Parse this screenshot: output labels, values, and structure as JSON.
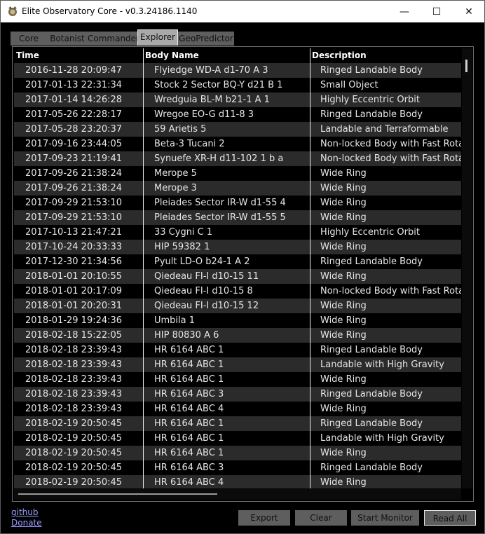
{
  "window": {
    "title": "Elite Observatory Core - v0.3.24186.1140",
    "minimize_glyph": "—",
    "maximize_glyph": "☐",
    "close_glyph": "✕"
  },
  "tabs": [
    "Core",
    "Botanist",
    "Commander",
    "Explorer",
    "GeoPredictor"
  ],
  "active_tab": "Explorer",
  "table": {
    "columns": [
      "Time",
      "Body Name",
      "Description"
    ],
    "rows": [
      [
        "2016-11-28 20:09:47",
        "Flyiedge WD-A d1-70 A 3",
        "Ringed Landable Body"
      ],
      [
        "2017-01-13 22:31:34",
        "Stock 2 Sector BQ-Y d21 B 1",
        "Small Object"
      ],
      [
        "2017-01-14 14:26:28",
        "Wredguia BL-M b21-1 A 1",
        "Highly Eccentric Orbit"
      ],
      [
        "2017-05-26 22:28:17",
        "Wregoe EO-G d11-8 3",
        "Ringed Landable Body"
      ],
      [
        "2017-05-28 23:20:37",
        "59 Arietis 5",
        "Landable and Terraformable"
      ],
      [
        "2017-09-16 23:44:05",
        "Beta-3 Tucani 2",
        "Non-locked Body with Fast Rotation"
      ],
      [
        "2017-09-23 21:19:41",
        "Synuefe XR-H d11-102 1 b a",
        "Non-locked Body with Fast Rotation"
      ],
      [
        "2017-09-26 21:38:24",
        "Merope 5",
        "Wide Ring"
      ],
      [
        "2017-09-26 21:38:24",
        "Merope 3",
        "Wide Ring"
      ],
      [
        "2017-09-29 21:53:10",
        "Pleiades Sector IR-W d1-55 4",
        "Wide Ring"
      ],
      [
        "2017-09-29 21:53:10",
        "Pleiades Sector IR-W d1-55 5",
        "Wide Ring"
      ],
      [
        "2017-10-13 21:47:21",
        "33 Cygni C 1",
        "Highly Eccentric Orbit"
      ],
      [
        "2017-10-24 20:33:33",
        "HIP 59382 1",
        "Wide Ring"
      ],
      [
        "2017-12-30 21:34:56",
        "Pyult LD-O b24-1 A 2",
        "Ringed Landable Body"
      ],
      [
        "2018-01-01 20:10:55",
        "Qiedeau FI-I d10-15 11",
        "Wide Ring"
      ],
      [
        "2018-01-01 20:17:09",
        "Qiedeau FI-I d10-15 8",
        "Non-locked Body with Fast Rotation"
      ],
      [
        "2018-01-01 20:20:31",
        "Qiedeau FI-I d10-15 12",
        "Wide Ring"
      ],
      [
        "2018-01-29 19:24:36",
        "Umbila 1",
        "Wide Ring"
      ],
      [
        "2018-02-18 15:22:05",
        "HIP 80830 A 6",
        "Wide Ring"
      ],
      [
        "2018-02-18 23:39:43",
        "HR 6164 ABC 1",
        "Ringed Landable Body"
      ],
      [
        "2018-02-18 23:39:43",
        "HR 6164 ABC 1",
        "Landable with High Gravity"
      ],
      [
        "2018-02-18 23:39:43",
        "HR 6164 ABC 1",
        "Wide Ring"
      ],
      [
        "2018-02-18 23:39:43",
        "HR 6164 ABC 3",
        "Ringed Landable Body"
      ],
      [
        "2018-02-18 23:39:43",
        "HR 6164 ABC 4",
        "Wide Ring"
      ],
      [
        "2018-02-19 20:50:45",
        "HR 6164 ABC 1",
        "Ringed Landable Body"
      ],
      [
        "2018-02-19 20:50:45",
        "HR 6164 ABC 1",
        "Landable with High Gravity"
      ],
      [
        "2018-02-19 20:50:45",
        "HR 6164 ABC 1",
        "Wide Ring"
      ],
      [
        "2018-02-19 20:50:45",
        "HR 6164 ABC 3",
        "Ringed Landable Body"
      ],
      [
        "2018-02-19 20:50:45",
        "HR 6164 ABC 4",
        "Wide Ring"
      ]
    ]
  },
  "footer": {
    "github_link": "github",
    "donate_link": "Donate",
    "export_label": "Export",
    "clear_label": "Clear",
    "start_monitor_label": "Start Monitor",
    "read_all_label": "Read All"
  },
  "colors": {
    "background": "#000000",
    "alt_row": "#2b2b2b",
    "button": "#5e5e5e",
    "active_tab": "#a9a9a9",
    "link": "#9a9aff"
  }
}
